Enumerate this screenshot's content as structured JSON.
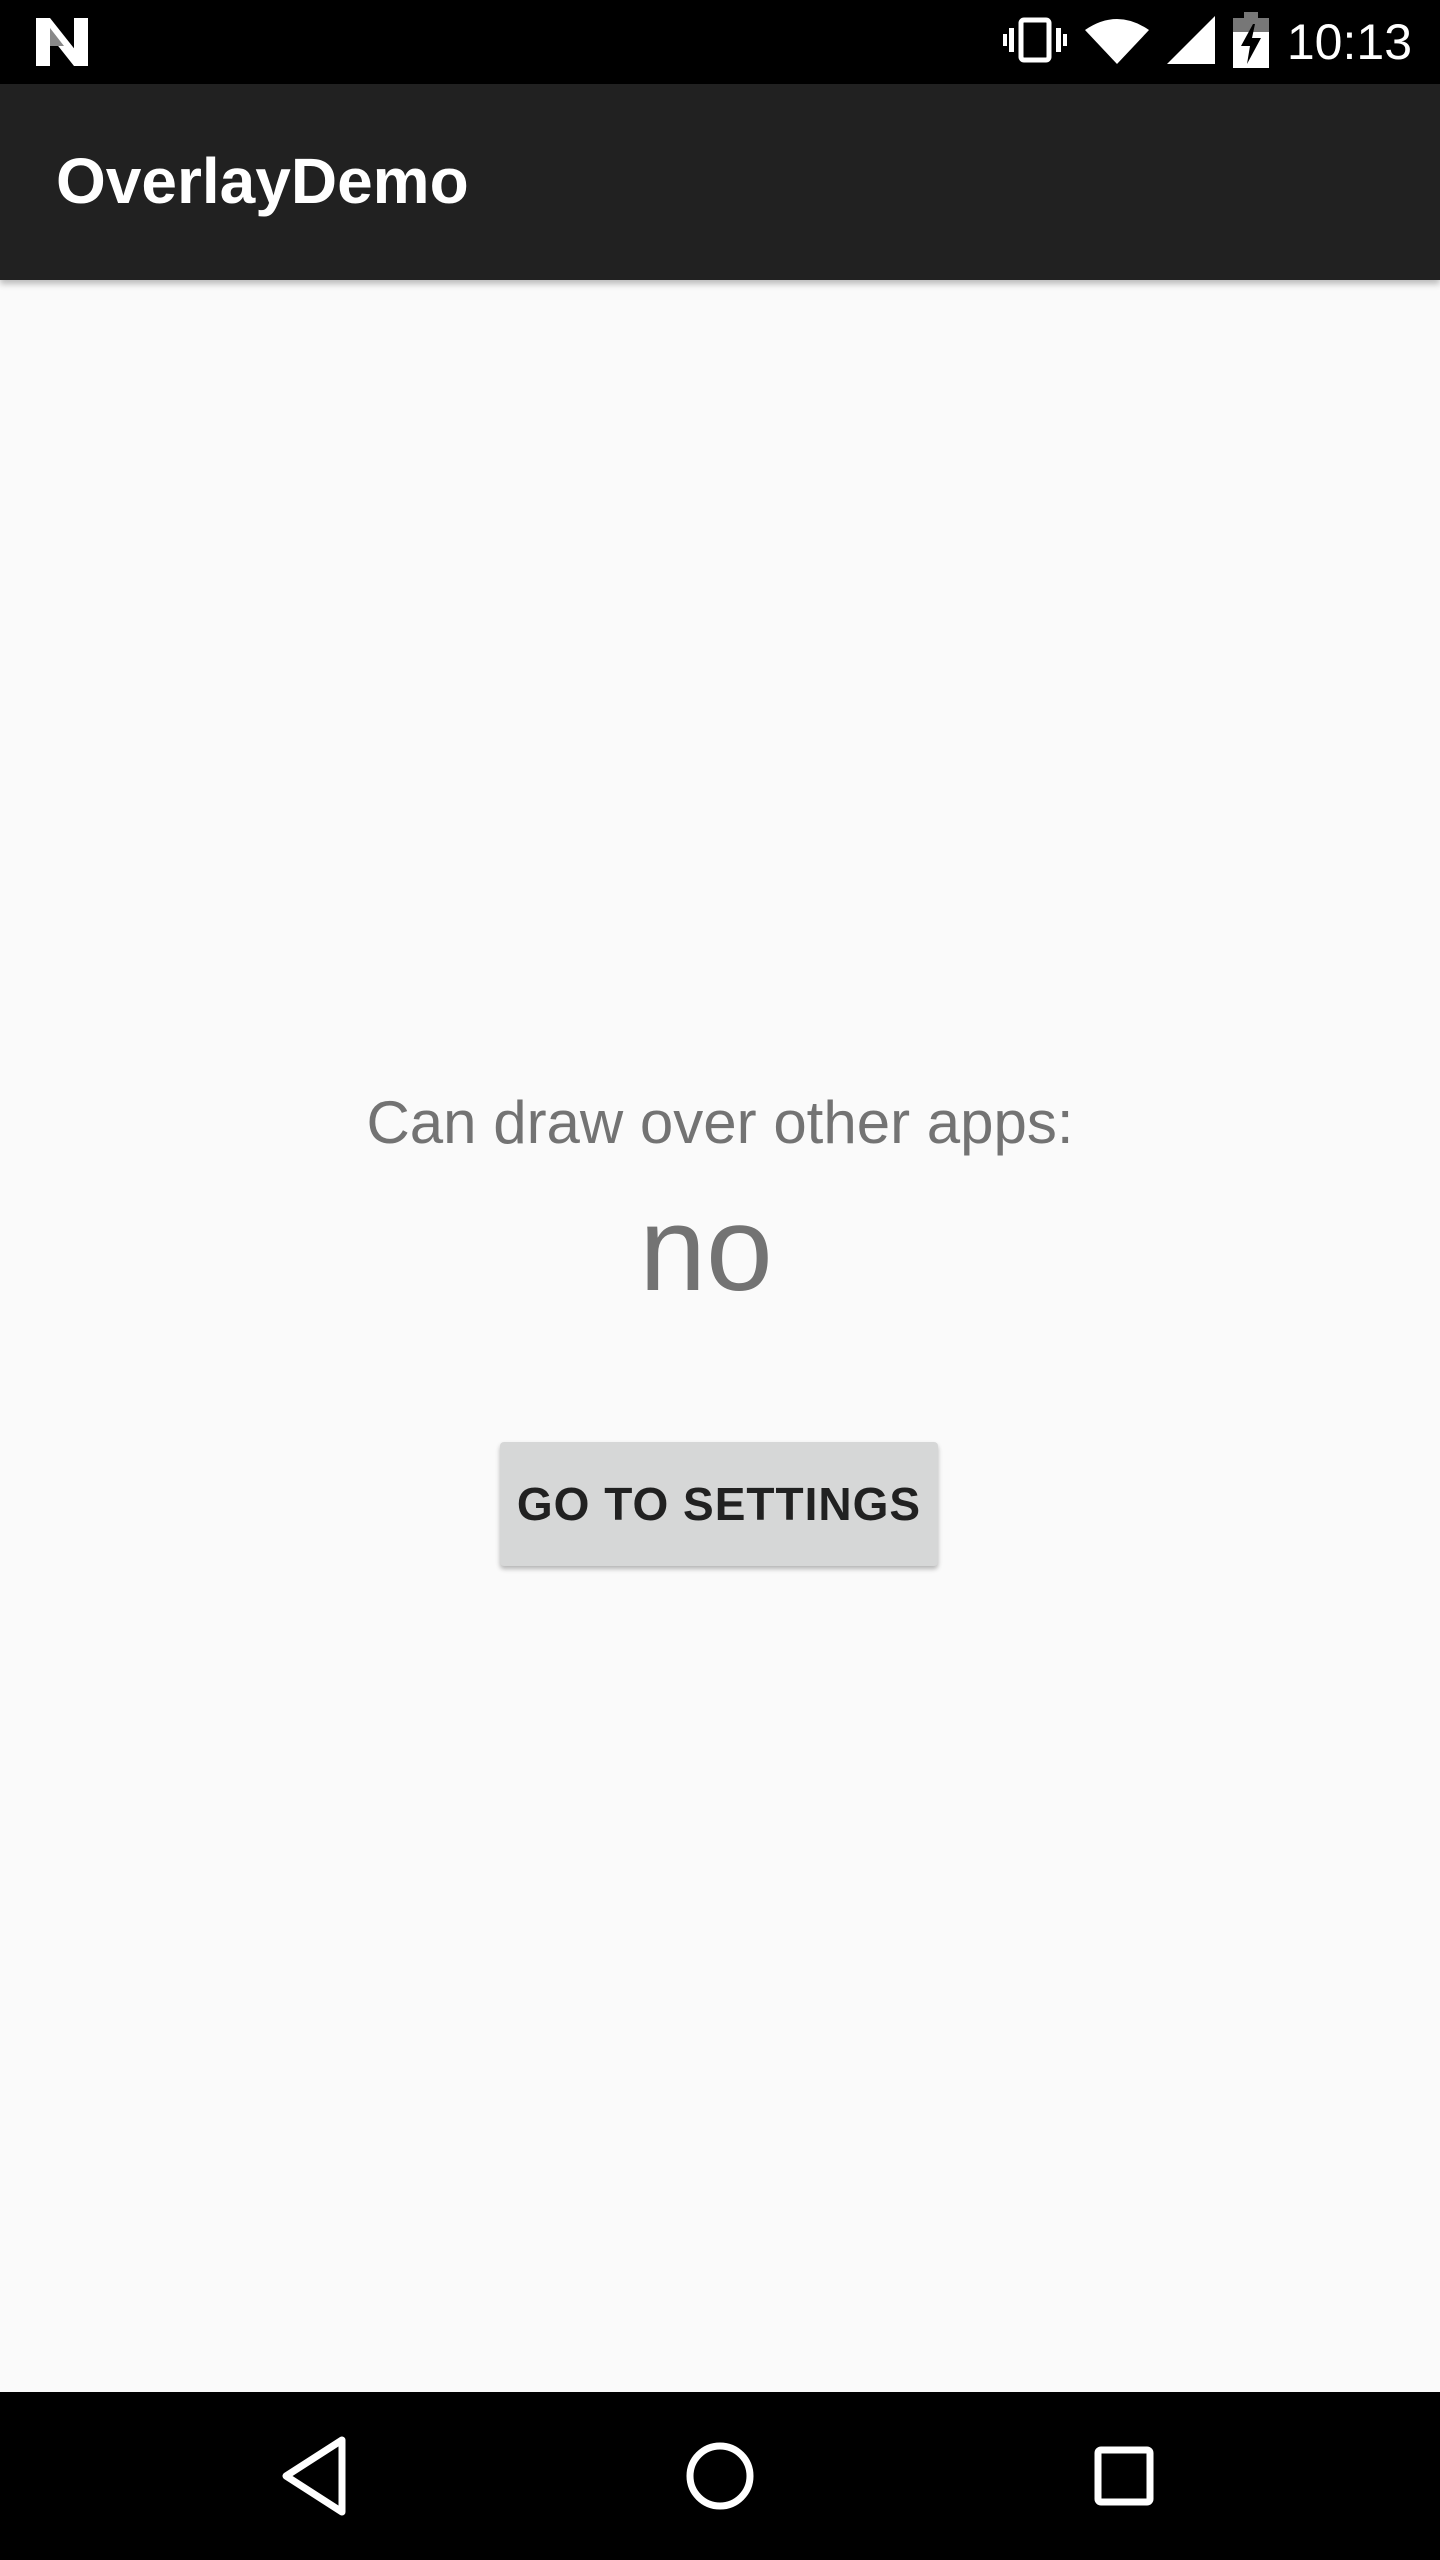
{
  "status_bar": {
    "time": "10:13",
    "icons": [
      "n-logo-icon",
      "vibrate-icon",
      "wifi-icon",
      "signal-icon",
      "battery-charging-icon"
    ]
  },
  "app_bar": {
    "title": "OverlayDemo"
  },
  "main": {
    "label": "Can draw over other apps:",
    "value": "no",
    "button_label": "GO TO SETTINGS"
  },
  "nav_bar": {
    "icons": [
      "back-icon",
      "home-icon",
      "recents-icon"
    ]
  },
  "colors": {
    "app_bar": "#212121",
    "background": "#fafafa",
    "text_secondary": "#737373",
    "button": "#d6d7d7"
  }
}
